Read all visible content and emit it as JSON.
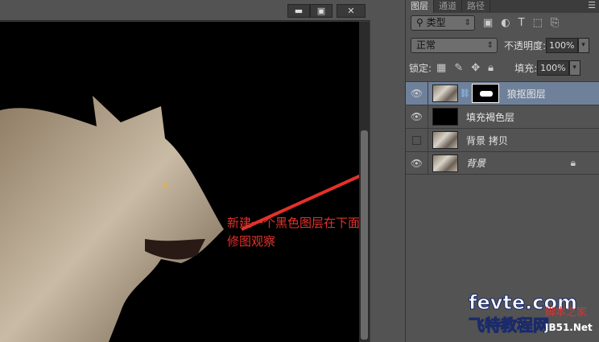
{
  "window": {
    "minimize": "▬",
    "maximize": "▣",
    "close": "✕"
  },
  "annotation": {
    "line1": "新建一个黑色图层在下面便于后面在狼抠图层蒙版上",
    "line2": "修图观察",
    "color": "#e4312b"
  },
  "panel": {
    "tabs": [
      {
        "label": "图层",
        "active": true
      },
      {
        "label": "通道"
      },
      {
        "label": "路径"
      }
    ],
    "filter": {
      "label": "类型",
      "icons": [
        "image-icon",
        "adjustment-icon",
        "type-icon",
        "shape-icon",
        "smart-object-icon"
      ]
    },
    "blend_mode": "正常",
    "opacity_label": "不透明度:",
    "opacity": "100%",
    "lock_label": "锁定:",
    "fill_label": "填充:",
    "fill": "100%",
    "layers": [
      {
        "name": "狼抠图层",
        "visible": true,
        "selected": true,
        "has_mask": true
      },
      {
        "name": "填充褐色层",
        "visible": true,
        "thumb": "black"
      },
      {
        "name": "背景 拷贝",
        "visible": false
      },
      {
        "name": "背景",
        "visible": true,
        "locked": true,
        "italic": true
      }
    ]
  },
  "watermark": {
    "line1": "fevte.com",
    "line2": "飞特教程网",
    "line3": "脚本之家",
    "line4": "JB51.Net"
  }
}
